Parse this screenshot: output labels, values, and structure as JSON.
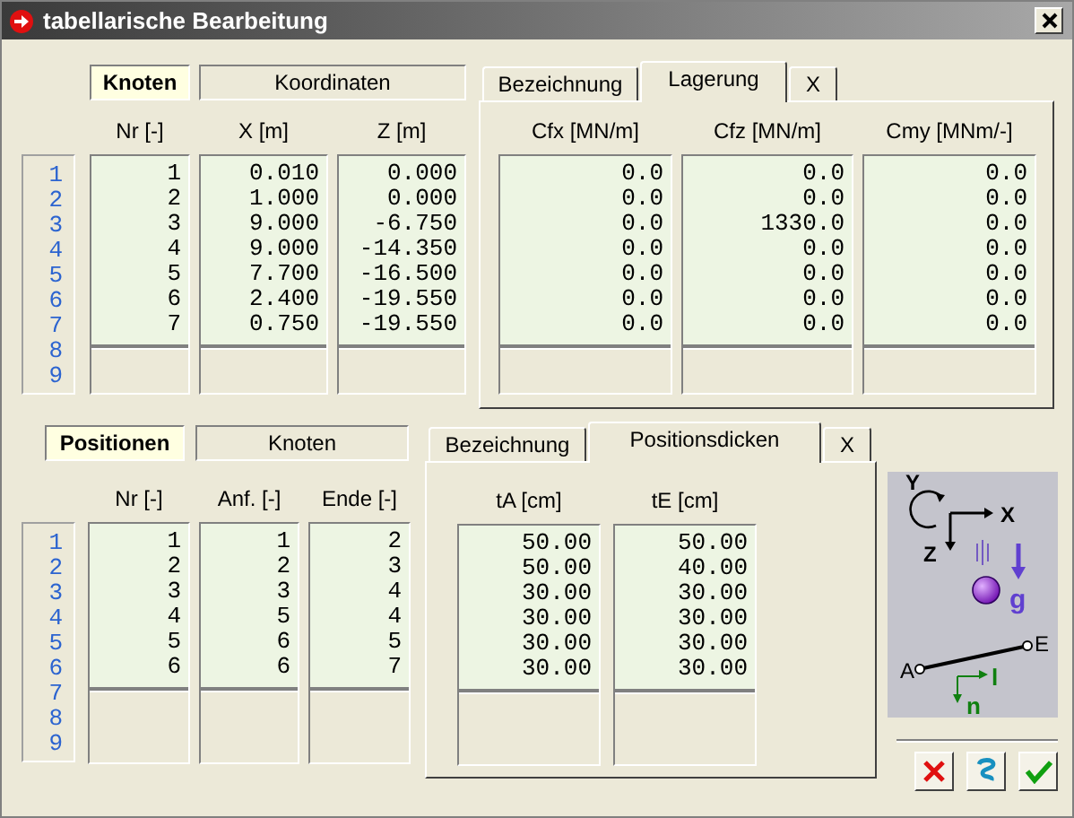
{
  "window": {
    "title": "tabellarische Bearbeitung"
  },
  "sections": [
    {
      "mode_tabs": [
        {
          "label": "Knoten",
          "selected": true
        },
        {
          "label": "Koordinaten",
          "selected": false
        }
      ],
      "row_numbers": [
        "1",
        "2",
        "3",
        "4",
        "5",
        "6",
        "7",
        "8",
        "9"
      ],
      "main_table": {
        "columns": [
          "Nr [-]",
          "X [m]",
          "Z [m]"
        ],
        "rows": [
          [
            "1",
            "0.010",
            "0.000"
          ],
          [
            "2",
            "1.000",
            "0.000"
          ],
          [
            "3",
            "9.000",
            "-6.750"
          ],
          [
            "4",
            "9.000",
            "-14.350"
          ],
          [
            "5",
            "7.700",
            "-16.500"
          ],
          [
            "6",
            "2.400",
            "-19.550"
          ],
          [
            "7",
            "0.750",
            "-19.550"
          ]
        ]
      },
      "detail_tabs": [
        {
          "label": "Bezeichnung",
          "selected": false
        },
        {
          "label": "Lagerung",
          "selected": true
        },
        {
          "label": "X",
          "selected": false
        }
      ],
      "detail_table": {
        "columns": [
          "Cfx [MN/m]",
          "Cfz [MN/m]",
          "Cmy [MNm/-]"
        ],
        "rows": [
          [
            "0.0",
            "0.0",
            "0.0"
          ],
          [
            "0.0",
            "0.0",
            "0.0"
          ],
          [
            "0.0",
            "1330.0",
            "0.0"
          ],
          [
            "0.0",
            "0.0",
            "0.0"
          ],
          [
            "0.0",
            "0.0",
            "0.0"
          ],
          [
            "0.0",
            "0.0",
            "0.0"
          ],
          [
            "0.0",
            "0.0",
            "0.0"
          ]
        ]
      }
    },
    {
      "mode_tabs": [
        {
          "label": "Positionen",
          "selected": true
        },
        {
          "label": "Knoten",
          "selected": false
        }
      ],
      "row_numbers": [
        "1",
        "2",
        "3",
        "4",
        "5",
        "6",
        "7",
        "8",
        "9"
      ],
      "main_table": {
        "columns": [
          "Nr [-]",
          "Anf. [-]",
          "Ende [-]"
        ],
        "rows": [
          [
            "1",
            "1",
            "2"
          ],
          [
            "2",
            "2",
            "3"
          ],
          [
            "3",
            "3",
            "4"
          ],
          [
            "4",
            "5",
            "4"
          ],
          [
            "5",
            "6",
            "5"
          ],
          [
            "6",
            "6",
            "7"
          ]
        ]
      },
      "detail_tabs": [
        {
          "label": "Bezeichnung",
          "selected": false
        },
        {
          "label": "Positionsdicken",
          "selected": true
        },
        {
          "label": "X",
          "selected": false
        }
      ],
      "detail_table": {
        "columns": [
          "tA [cm]",
          "tE [cm]"
        ],
        "rows": [
          [
            "50.00",
            "50.00"
          ],
          [
            "50.00",
            "40.00"
          ],
          [
            "30.00",
            "30.00"
          ],
          [
            "30.00",
            "30.00"
          ],
          [
            "30.00",
            "30.00"
          ],
          [
            "30.00",
            "30.00"
          ]
        ]
      }
    }
  ],
  "diagram": {
    "axis_y": "Y",
    "axis_x": "X",
    "axis_z": "Z",
    "gravity": "g",
    "start": "A",
    "end": "E",
    "local_l": "l",
    "local_n": "n"
  }
}
